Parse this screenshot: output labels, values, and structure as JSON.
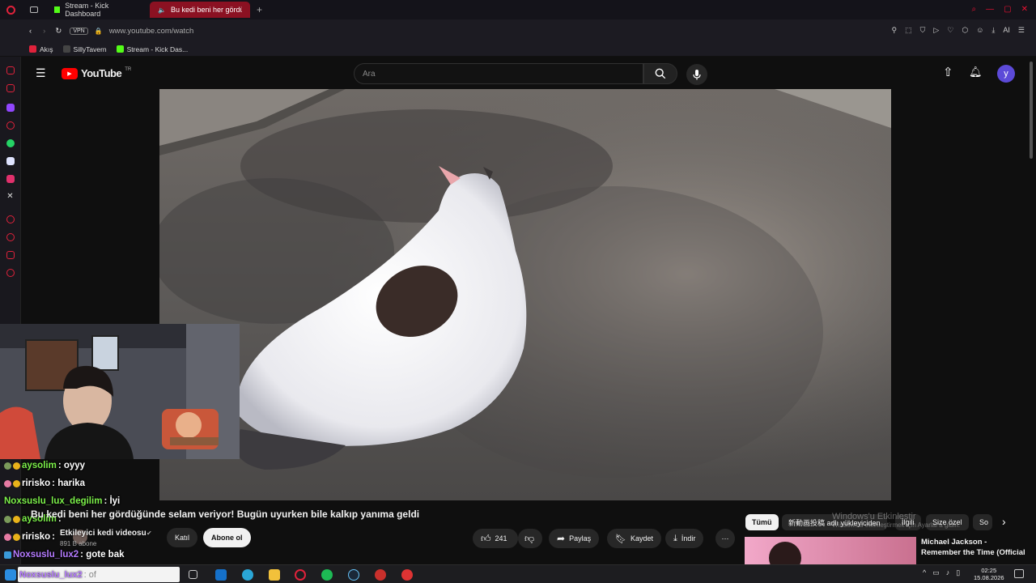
{
  "browser": {
    "tabs": [
      {
        "label": "Stream - Kick Dashboard"
      },
      {
        "label": "Bu kedi beni her gördü"
      }
    ],
    "url": "www.youtube.com/watch",
    "vpn_label": "VPN",
    "ai_label": "AI",
    "bookmarks": [
      {
        "label": "Akış"
      },
      {
        "label": "SillyTavern"
      },
      {
        "label": "Stream - Kick Das..."
      }
    ]
  },
  "youtube": {
    "logo_text": "YouTube",
    "region": "TR",
    "search_placeholder": "Ara",
    "avatar_letter": "y",
    "video_title": "Bu kedi beni her gördüğünde selam veriyor! Bugün uyurken bile kalkıp yanıma geldi",
    "channel_name": "Etkileyici kedi videosu",
    "subscribers": "891 B abone",
    "join_label": "Katıl",
    "subscribe_label": "Abone ol",
    "like_count": "241",
    "share_label": "Paylaş",
    "save_label": "Kaydet",
    "download_label": "İndir",
    "chips": [
      "Tümü",
      "新動画投稿 adlı yükleyiciden",
      "İlgili",
      "Size özel",
      "So"
    ],
    "rec_title_1": "Michael Jackson -",
    "rec_title_2": "Remember the Time (Official"
  },
  "watermark": {
    "line1": "Windows'u Etkinleştir",
    "line2": "Windows'u etkinleştirmek için Ayarlar'a gidin."
  },
  "chat": [
    {
      "user": "aysolim",
      "text": ": oyyy",
      "color": "#7cf04a"
    },
    {
      "user": "ririsko",
      "text": ": harika",
      "color": "#ffffff"
    },
    {
      "user": "Noxsuslu_lux_degilim",
      "text": ": İyi",
      "color": "#7cf04a"
    },
    {
      "user": "aysolim",
      "text": ":",
      "color": "#7cf04a"
    },
    {
      "user": "ririsko",
      "text": ":",
      "color": "#ffffff"
    },
    {
      "user": "Noxsuslu_lux2",
      "text": ": gote bak",
      "color": "#b57bff"
    },
    {
      "user": "Noxsuslu_lux2",
      "text": ": of",
      "color": "#b57bff"
    }
  ],
  "taskbar": {
    "time": "02:25",
    "date": "15.08.2026"
  }
}
